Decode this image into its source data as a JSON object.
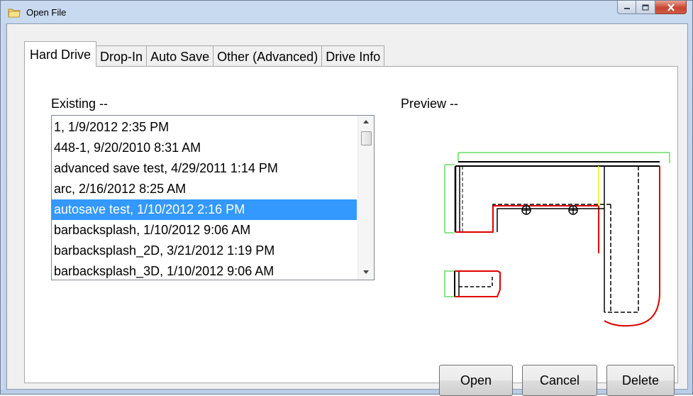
{
  "window": {
    "title": "Open File",
    "icon": "folder-icon",
    "controls": {
      "minimize": "minimize-icon",
      "maximize": "maximize-icon",
      "close": "close-icon"
    }
  },
  "tabs": [
    {
      "label": "Hard Drive",
      "active": true
    },
    {
      "label": "Drop-In",
      "active": false
    },
    {
      "label": "Auto Save",
      "active": false
    },
    {
      "label": "Other (Advanced)",
      "active": false
    },
    {
      "label": "Drive Info",
      "active": false
    }
  ],
  "existing": {
    "label": "Existing --",
    "items": [
      "1, 1/9/2012 2:35 PM",
      "448-1, 9/20/2010 8:31 AM",
      "advanced save test, 4/29/2011 1:14 PM",
      "arc, 2/16/2012 8:25 AM",
      "autosave test, 1/10/2012 2:16 PM",
      "barbacksplash, 1/10/2012 9:06 AM",
      "barbacksplash_2D, 3/21/2012 1:19 PM",
      "barbacksplash_3D, 1/10/2012 9:06 AM"
    ],
    "selected_index": 4
  },
  "preview": {
    "label": "Preview --",
    "colors": {
      "outline": "#000000",
      "edge_red": "#e00000",
      "edge_green": "#66dd66",
      "edge_yellow": "#ffee00"
    }
  },
  "buttons": {
    "open": "Open",
    "cancel": "Cancel",
    "delete": "Delete"
  },
  "colors": {
    "selection": "#3399ff",
    "titlebar": "#c9daf0"
  }
}
